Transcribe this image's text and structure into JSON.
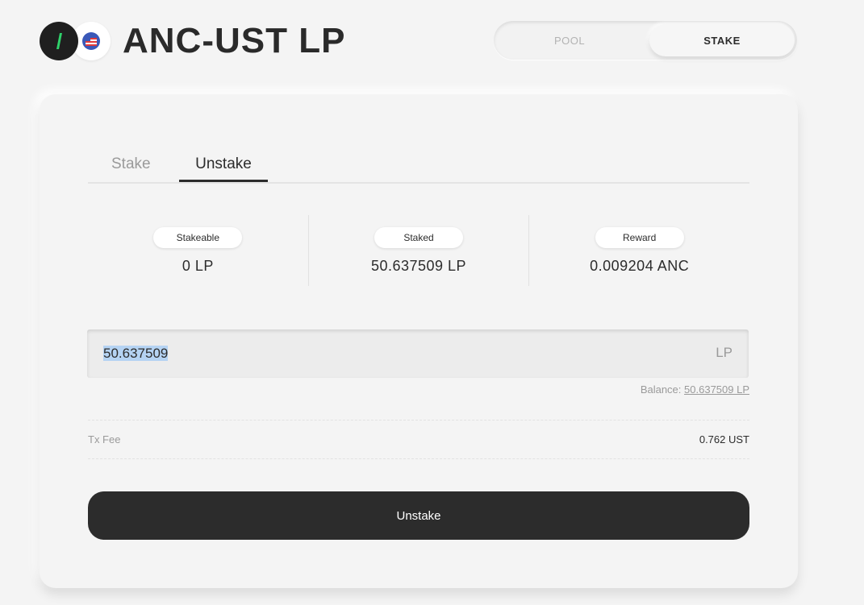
{
  "header": {
    "title": "ANC-UST LP",
    "token_a_icon": "anchor-token-icon",
    "token_b_icon": "ust-token-icon"
  },
  "segmented_tabs": {
    "items": [
      {
        "label": "POOL",
        "active": false
      },
      {
        "label": "STAKE",
        "active": true
      }
    ]
  },
  "tabs": [
    {
      "label": "Stake",
      "active": false
    },
    {
      "label": "Unstake",
      "active": true
    }
  ],
  "stats": [
    {
      "label": "Stakeable",
      "value": "0 LP"
    },
    {
      "label": "Staked",
      "value": "50.637509 LP"
    },
    {
      "label": "Reward",
      "value": "0.009204 ANC"
    }
  ],
  "amount_input": {
    "value": "50.637509",
    "unit": "LP"
  },
  "balance": {
    "label": "Balance:",
    "value": "50.637509 LP"
  },
  "tx_fee": {
    "label": "Tx Fee",
    "value": "0.762 UST"
  },
  "submit_button": {
    "label": "Unstake"
  },
  "colors": {
    "background": "#f4f4f4",
    "primary_dark": "#2c2c2c",
    "muted_text": "#9a9a9a",
    "selection": "#b5d3f3",
    "anc_green": "#2fd16a"
  }
}
